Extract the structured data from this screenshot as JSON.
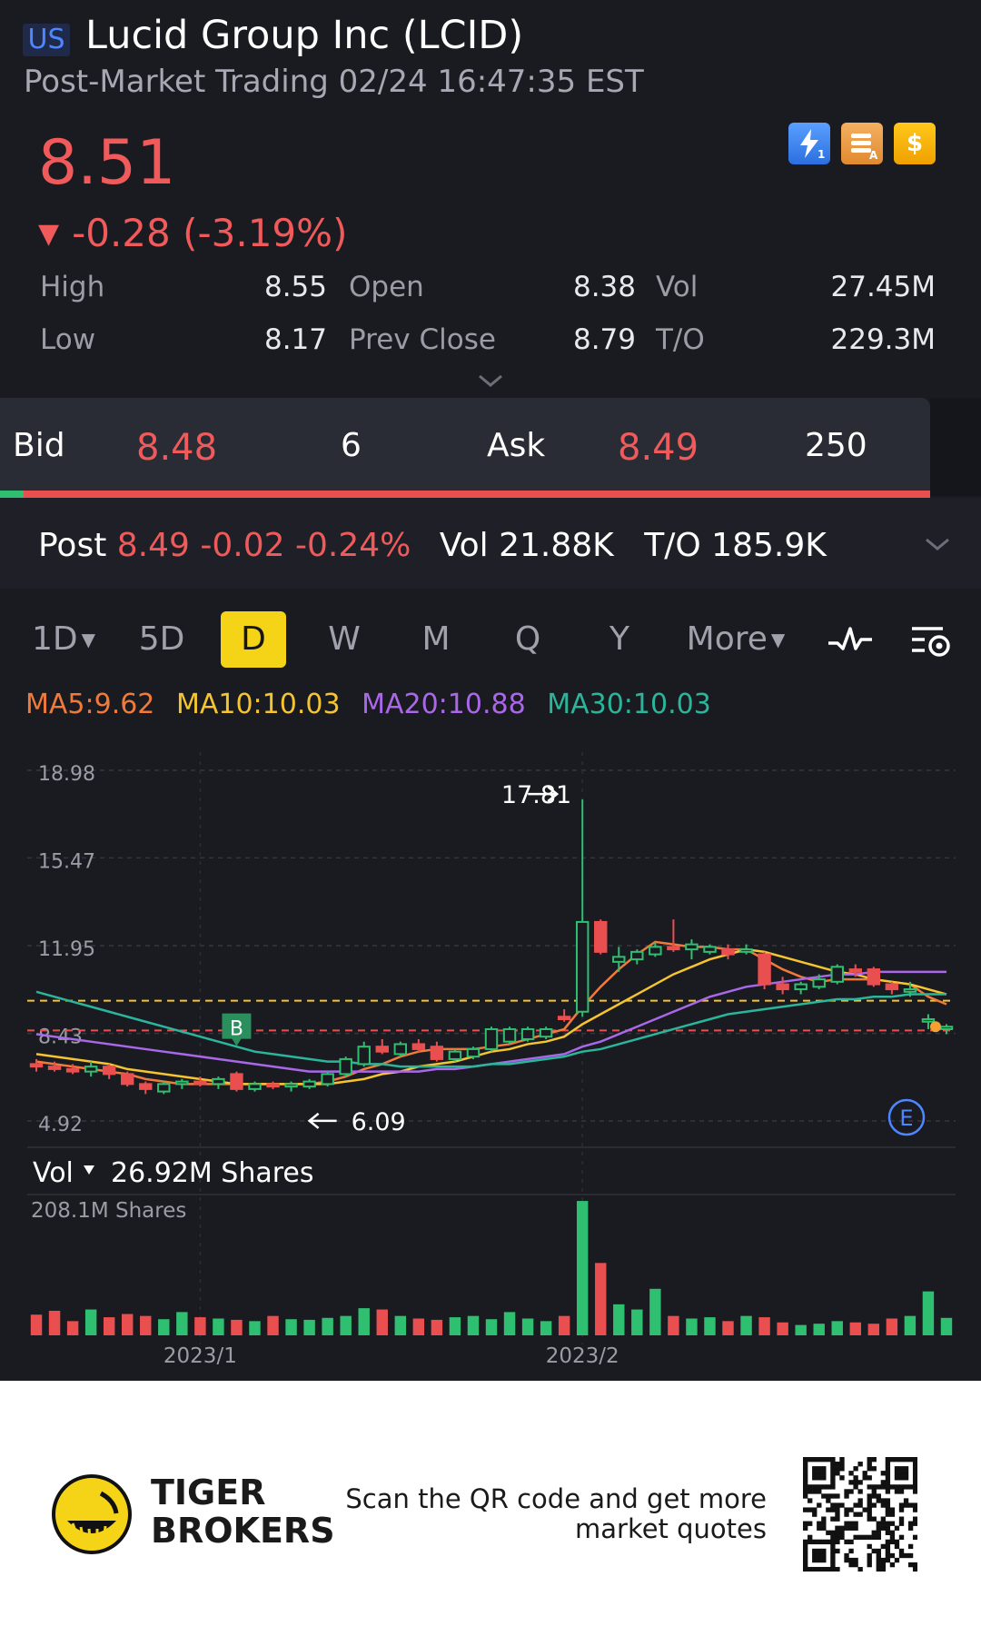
{
  "header": {
    "market": "US",
    "title": "Lucid Group Inc (LCID)",
    "subtitle": "Post-Market Trading 02/24 16:47:35 EST",
    "price": "8.51",
    "change": "-0.28 (-3.19%)",
    "down_symbol": "▼",
    "badges": [
      {
        "icon": "lightning-icon",
        "label": "1",
        "color": "#3b82f6"
      },
      {
        "icon": "stack-icon",
        "label": "A",
        "color": "#f0a040"
      },
      {
        "icon": "dollar-icon",
        "label": "$",
        "color": "#f5b400"
      }
    ]
  },
  "stats": [
    {
      "label": "High",
      "value": "8.55"
    },
    {
      "label": "Open",
      "value": "8.38"
    },
    {
      "label": "Vol",
      "value": "27.45M"
    },
    {
      "label": "Low",
      "value": "8.17"
    },
    {
      "label": "Prev Close",
      "value": "8.79"
    },
    {
      "label": "T/O",
      "value": "229.3M"
    }
  ],
  "bidask": {
    "bid_label": "Bid",
    "bid_price": "8.48",
    "bid_size": "6",
    "ask_label": "Ask",
    "ask_price": "8.49",
    "ask_size": "250"
  },
  "post": {
    "label": "Post",
    "price": "8.49",
    "change": "-0.02",
    "pct": "-0.24%",
    "vol_label": "Vol",
    "vol": "21.88K",
    "to_label": "T/O",
    "to": "185.9K"
  },
  "tabs": [
    "1D",
    "5D",
    "D",
    "W",
    "M",
    "Q",
    "Y",
    "More"
  ],
  "active_tab": "D",
  "colors": {
    "up": "#2fbf71",
    "down": "#ea4f4f",
    "ma5": "#f07a3a",
    "ma10": "#f5c431",
    "ma20": "#a968e8",
    "ma30": "#2bb59b",
    "accent": "#f5d418"
  },
  "ma_legend": [
    {
      "text": "MA5:9.62",
      "color": "#f07a3a"
    },
    {
      "text": "MA10:10.03",
      "color": "#f5c431"
    },
    {
      "text": "MA20:10.88",
      "color": "#a968e8"
    },
    {
      "text": "MA30:10.03",
      "color": "#2bb59b"
    }
  ],
  "chart_data": {
    "type": "candlestick",
    "ylim": [
      4.92,
      18.98
    ],
    "y_ticks": [
      "18.98",
      "15.47",
      "11.95",
      "8.43",
      "4.92"
    ],
    "x_ticks": [
      "2023/1",
      "2023/2"
    ],
    "annotations": {
      "high": "17.81",
      "low": "6.09",
      "buy_marker": "B",
      "earnings_marker": "E"
    },
    "candles": [
      [
        7.2,
        7.4,
        6.9,
        7.1
      ],
      [
        7.1,
        7.3,
        6.9,
        7.0
      ],
      [
        7.0,
        7.2,
        6.8,
        6.9
      ],
      [
        6.9,
        7.3,
        6.7,
        7.1
      ],
      [
        7.1,
        7.2,
        6.6,
        6.8
      ],
      [
        6.8,
        6.9,
        6.3,
        6.4
      ],
      [
        6.4,
        6.5,
        6.0,
        6.2
      ],
      [
        6.1,
        6.5,
        6.0,
        6.4
      ],
      [
        6.4,
        6.6,
        6.2,
        6.5
      ],
      [
        6.5,
        6.7,
        6.3,
        6.4
      ],
      [
        6.4,
        6.7,
        6.2,
        6.6
      ],
      [
        6.8,
        6.9,
        6.1,
        6.2
      ],
      [
        6.2,
        6.5,
        6.1,
        6.4
      ],
      [
        6.4,
        6.5,
        6.2,
        6.3
      ],
      [
        6.3,
        6.5,
        6.1,
        6.4
      ],
      [
        6.3,
        6.6,
        6.2,
        6.5
      ],
      [
        6.4,
        6.9,
        6.3,
        6.8
      ],
      [
        6.8,
        7.5,
        6.7,
        7.4
      ],
      [
        7.2,
        8.1,
        7.1,
        7.9
      ],
      [
        7.9,
        8.2,
        7.6,
        7.7
      ],
      [
        7.6,
        8.1,
        7.5,
        8.0
      ],
      [
        8.0,
        8.2,
        7.7,
        7.8
      ],
      [
        7.9,
        8.1,
        7.3,
        7.4
      ],
      [
        7.4,
        7.8,
        7.3,
        7.7
      ],
      [
        7.5,
        7.9,
        7.4,
        7.8
      ],
      [
        7.8,
        8.7,
        7.7,
        8.6
      ],
      [
        8.1,
        8.7,
        8.0,
        8.6
      ],
      [
        8.2,
        8.7,
        8.1,
        8.6
      ],
      [
        8.3,
        8.7,
        8.2,
        8.6
      ],
      [
        9.1,
        9.4,
        8.9,
        9.0
      ],
      [
        9.3,
        17.81,
        9.1,
        12.9
      ],
      [
        12.9,
        13.0,
        11.6,
        11.7
      ],
      [
        11.3,
        11.9,
        10.9,
        11.5
      ],
      [
        11.4,
        11.8,
        11.2,
        11.7
      ],
      [
        11.6,
        12.1,
        11.5,
        11.9
      ],
      [
        11.9,
        13.0,
        11.7,
        11.8
      ],
      [
        11.8,
        12.2,
        11.4,
        12.0
      ],
      [
        11.7,
        12.0,
        11.6,
        11.9
      ],
      [
        11.8,
        12.0,
        11.4,
        11.6
      ],
      [
        11.7,
        12.0,
        11.6,
        11.8
      ],
      [
        11.6,
        11.7,
        10.2,
        10.4
      ],
      [
        10.4,
        10.7,
        10.0,
        10.2
      ],
      [
        10.2,
        10.5,
        10.0,
        10.4
      ],
      [
        10.3,
        10.8,
        10.2,
        10.6
      ],
      [
        10.5,
        11.2,
        10.4,
        11.1
      ],
      [
        11.0,
        11.2,
        10.7,
        10.9
      ],
      [
        11.0,
        11.1,
        10.3,
        10.4
      ],
      [
        10.4,
        10.5,
        10.0,
        10.2
      ],
      [
        10.1,
        10.5,
        9.9,
        10.2
      ],
      [
        8.9,
        9.2,
        8.6,
        9.0
      ],
      [
        8.6,
        8.8,
        8.4,
        8.7
      ]
    ],
    "ma_lines": {
      "ma5": [
        7.3,
        7.2,
        7.1,
        7.0,
        6.9,
        6.8,
        6.6,
        6.5,
        6.4,
        6.4,
        6.4,
        6.4,
        6.4,
        6.4,
        6.4,
        6.4,
        6.5,
        6.7,
        7.0,
        7.2,
        7.5,
        7.7,
        7.8,
        7.8,
        7.8,
        7.9,
        8.0,
        8.2,
        8.4,
        8.6,
        9.5,
        10.3,
        11.0,
        11.6,
        12.1,
        12.0,
        11.9,
        11.9,
        11.8,
        11.8,
        11.4,
        11.0,
        10.7,
        10.5,
        10.6,
        10.6,
        10.6,
        10.5,
        10.4,
        9.9,
        9.6
      ],
      "ma10": [
        7.6,
        7.5,
        7.4,
        7.3,
        7.2,
        7.0,
        6.9,
        6.8,
        6.7,
        6.6,
        6.5,
        6.4,
        6.4,
        6.4,
        6.4,
        6.4,
        6.4,
        6.5,
        6.6,
        6.8,
        6.9,
        7.1,
        7.2,
        7.3,
        7.5,
        7.7,
        7.8,
        8.0,
        8.1,
        8.3,
        8.8,
        9.2,
        9.6,
        10.0,
        10.4,
        10.8,
        11.1,
        11.4,
        11.6,
        11.8,
        11.7,
        11.5,
        11.3,
        11.1,
        10.9,
        10.8,
        10.6,
        10.5,
        10.4,
        10.2,
        10.0
      ],
      "ma20": [
        8.4,
        8.3,
        8.2,
        8.1,
        8.0,
        7.9,
        7.8,
        7.7,
        7.6,
        7.5,
        7.4,
        7.3,
        7.2,
        7.1,
        7.0,
        6.9,
        6.9,
        6.9,
        6.9,
        6.9,
        6.9,
        6.9,
        7.0,
        7.0,
        7.1,
        7.2,
        7.3,
        7.4,
        7.5,
        7.6,
        7.9,
        8.1,
        8.4,
        8.7,
        9.0,
        9.3,
        9.6,
        9.9,
        10.1,
        10.3,
        10.4,
        10.5,
        10.6,
        10.7,
        10.8,
        10.8,
        10.9,
        10.9,
        10.9,
        10.9,
        10.9
      ],
      "ma30": [
        10.1,
        9.9,
        9.7,
        9.5,
        9.3,
        9.1,
        8.9,
        8.7,
        8.5,
        8.3,
        8.1,
        7.9,
        7.7,
        7.6,
        7.5,
        7.4,
        7.3,
        7.3,
        7.2,
        7.2,
        7.1,
        7.1,
        7.1,
        7.1,
        7.1,
        7.2,
        7.2,
        7.3,
        7.4,
        7.5,
        7.7,
        7.8,
        8.0,
        8.2,
        8.4,
        8.6,
        8.8,
        9.0,
        9.2,
        9.3,
        9.4,
        9.5,
        9.6,
        9.7,
        9.8,
        9.8,
        9.9,
        9.9,
        10.0,
        10.0,
        10.0
      ]
    },
    "reference_lines": {
      "prev_close": 9.74,
      "last_price": 8.55
    },
    "volume": {
      "label": "Vol",
      "current": "26.92M Shares",
      "max_label": "208.1M Shares",
      "max": 208.1,
      "values": [
        32,
        38,
        22,
        40,
        28,
        33,
        30,
        25,
        36,
        28,
        26,
        24,
        22,
        30,
        25,
        24,
        27,
        30,
        42,
        40,
        30,
        26,
        24,
        28,
        30,
        25,
        36,
        26,
        22,
        30,
        208,
        112,
        48,
        40,
        72,
        30,
        26,
        28,
        22,
        30,
        28,
        20,
        16,
        18,
        22,
        20,
        18,
        26,
        30,
        68,
        27
      ]
    }
  },
  "footer": {
    "brand_line1": "TIGER",
    "brand_line2": "BROKERS",
    "scan_line1": "Scan the QR code and get more",
    "scan_line2": "market quotes"
  }
}
